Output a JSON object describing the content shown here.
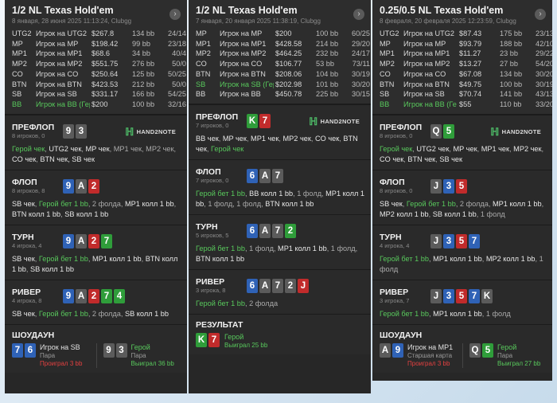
{
  "panels": [
    {
      "title": "1/2 NL Texas Hold'em",
      "subtitle": "8 января, 28 июня 2025 11:13:24, Clubgg",
      "players": [
        {
          "pos": "UTG2",
          "name": "Игрок на UTG2",
          "stack": "$267.8",
          "bb": "134 bb",
          "count": "24/14",
          "hero": false
        },
        {
          "pos": "MP",
          "name": "Игрок на MP",
          "stack": "$198.42",
          "bb": "99 bb",
          "count": "23/18",
          "hero": false
        },
        {
          "pos": "MP1",
          "name": "Игрок на MP1",
          "stack": "$68.6",
          "bb": "34 bb",
          "count": "40/4",
          "hero": false
        },
        {
          "pos": "MP2",
          "name": "Игрок на MP2",
          "stack": "$551.75",
          "bb": "276 bb",
          "count": "50/0",
          "hero": false
        },
        {
          "pos": "CO",
          "name": "Игрок на CO",
          "stack": "$250.64",
          "bb": "125 bb",
          "count": "50/25",
          "hero": false
        },
        {
          "pos": "BTN",
          "name": "Игрок на BTN",
          "stack": "$423.53",
          "bb": "212 bb",
          "count": "50/0",
          "hero": false
        },
        {
          "pos": "SB",
          "name": "Игрок на SB",
          "stack": "$331.17",
          "bb": "166 bb",
          "count": "54/25",
          "hero": false
        },
        {
          "pos": "BB",
          "name": "Игрок на BB (Гер",
          "stack": "$200",
          "bb": "100 bb",
          "count": "32/16",
          "hero": true
        }
      ],
      "logo": "HAND2NOTE",
      "sections": [
        {
          "name": "ПРЕФЛОП",
          "sub": "8 игроков, 0",
          "cards": [
            {
              "r": "9",
              "s": "s"
            },
            {
              "r": "3",
              "s": "s"
            }
          ],
          "actions": [
            [
              "Герой чек",
              "g"
            ],
            [
              ", ",
              "m"
            ],
            [
              "UTG2 чек",
              "w"
            ],
            [
              ", ",
              "m"
            ],
            [
              "MP чек",
              "w"
            ],
            [
              ", MP1 чек, MP2 чек, ",
              "m"
            ],
            [
              "CO чек",
              "w"
            ],
            [
              ", ",
              "m"
            ],
            [
              "BTN чек",
              "w"
            ],
            [
              ", SB чек",
              "w"
            ]
          ]
        },
        {
          "name": "ФЛОП",
          "sub": "8 игроков, 8",
          "cards": [
            {
              "r": "9",
              "s": "d"
            },
            {
              "r": "A",
              "s": "s"
            },
            {
              "r": "2",
              "s": "h"
            }
          ],
          "actions": [
            [
              "SB чек",
              "w"
            ],
            [
              ", ",
              "m"
            ],
            [
              "Герой бет 1 bb",
              "g"
            ],
            [
              ", 2 фолда, ",
              "m"
            ],
            [
              "MP1 колл 1 bb",
              "w"
            ],
            [
              ", ",
              "m"
            ],
            [
              "BTN колл 1 bb",
              "w"
            ],
            [
              ", ",
              "m"
            ],
            [
              "SB колл 1 bb",
              "w"
            ]
          ]
        },
        {
          "name": "ТУРН",
          "sub": "4 игрока, 4",
          "cards": [
            {
              "r": "9",
              "s": "d"
            },
            {
              "r": "A",
              "s": "s"
            },
            {
              "r": "2",
              "s": "h"
            },
            {
              "r": "7",
              "s": "c"
            }
          ],
          "actions": [
            [
              "SB чек",
              "w"
            ],
            [
              ", ",
              "m"
            ],
            [
              "Герой бет 1 bb",
              "g"
            ],
            [
              ", ",
              "m"
            ],
            [
              "MP1 колл 1 bb",
              "w"
            ],
            [
              ", ",
              "m"
            ],
            [
              "BTN колл 1 bb",
              "w"
            ],
            [
              ", ",
              "m"
            ],
            [
              "SB колл 1 bb",
              "w"
            ]
          ]
        },
        {
          "name": "РИВЕР",
          "sub": "4 игрока, 8",
          "cards": [
            {
              "r": "9",
              "s": "d"
            },
            {
              "r": "A",
              "s": "s"
            },
            {
              "r": "2",
              "s": "h"
            },
            {
              "r": "7",
              "s": "c"
            },
            {
              "r": "4",
              "s": "c"
            }
          ],
          "actions": [
            [
              "SB чек",
              "w"
            ],
            [
              ", ",
              "m"
            ],
            [
              "Герой бет 1 bb",
              "g"
            ],
            [
              ", 2 фолда, ",
              "m"
            ],
            [
              "SB колл 1 bb",
              "w"
            ]
          ]
        }
      ],
      "showdown": {
        "name": "ШОУДАУН",
        "left": {
          "cards": [
            {
              "r": "7",
              "s": "d"
            },
            {
              "r": "6",
              "s": "d"
            }
          ],
          "name": "Игрок на SB",
          "desc": "Пара",
          "result": "Проиграл 3 bb",
          "win": false
        },
        "right": {
          "cards": [
            {
              "r": "9",
              "s": "s"
            },
            {
              "r": "3",
              "s": "s"
            }
          ],
          "name": "Герой",
          "desc": "Пара",
          "result": "Выиграл 36 bb",
          "win": true
        }
      }
    },
    {
      "title": "1/2 NL Texas Hold'em",
      "subtitle": "7 января, 20 января 2025 11:38:19, Clubgg",
      "players": [
        {
          "pos": "MP",
          "name": "Игрок на MP",
          "stack": "$200",
          "bb": "100 bb",
          "count": "60/25",
          "hero": false
        },
        {
          "pos": "MP1",
          "name": "Игрок на MP1",
          "stack": "$428.58",
          "bb": "214 bb",
          "count": "29/20",
          "hero": false
        },
        {
          "pos": "MP2",
          "name": "Игрок на MP2",
          "stack": "$464.25",
          "bb": "232 bb",
          "count": "24/17",
          "hero": false
        },
        {
          "pos": "CO",
          "name": "Игрок на CO",
          "stack": "$106.77",
          "bb": "53 bb",
          "count": "73/11",
          "hero": false
        },
        {
          "pos": "BTN",
          "name": "Игрок на BTN",
          "stack": "$208.06",
          "bb": "104 bb",
          "count": "30/19",
          "hero": false
        },
        {
          "pos": "SB",
          "name": "Игрок на SB (Гер",
          "stack": "$202.98",
          "bb": "101 bb",
          "count": "30/20",
          "hero": true
        },
        {
          "pos": "BB",
          "name": "Игрок на BB",
          "stack": "$450.78",
          "bb": "225 bb",
          "count": "30/15",
          "hero": false
        }
      ],
      "logo": "HAND2NOTE",
      "sections": [
        {
          "name": "ПРЕФЛОП",
          "sub": "7 игроков, 0",
          "cards": [
            {
              "r": "K",
              "s": "c"
            },
            {
              "r": "7",
              "s": "h"
            }
          ],
          "actions": [
            [
              "BB чек",
              "w"
            ],
            [
              ", ",
              "m"
            ],
            [
              "MP чек",
              "w"
            ],
            [
              ", ",
              "m"
            ],
            [
              "MP1 чек",
              "w"
            ],
            [
              ", ",
              "m"
            ],
            [
              "MP2 чек",
              "w"
            ],
            [
              ", ",
              "m"
            ],
            [
              "CO чек",
              "w"
            ],
            [
              ", ",
              "m"
            ],
            [
              "BTN чек",
              "w"
            ],
            [
              ", ",
              "m"
            ],
            [
              "Герой чек",
              "g"
            ]
          ]
        },
        {
          "name": "ФЛОП",
          "sub": "7 игроков, 0",
          "cards": [
            {
              "r": "6",
              "s": "d"
            },
            {
              "r": "A",
              "s": "s"
            },
            {
              "r": "7",
              "s": "s"
            }
          ],
          "actions": [
            [
              "Герой бет 1 bb",
              "g"
            ],
            [
              ", ",
              "m"
            ],
            [
              "BB колл 1 bb",
              "w"
            ],
            [
              ", 1 фолд, ",
              "m"
            ],
            [
              "MP1 колл 1 bb",
              "w"
            ],
            [
              ", 1 фолд, 1 фолд, ",
              "m"
            ],
            [
              "BTN колл 1 bb",
              "w"
            ]
          ]
        },
        {
          "name": "ТУРН",
          "sub": "5 игроков, 5",
          "cards": [
            {
              "r": "6",
              "s": "d"
            },
            {
              "r": "A",
              "s": "s"
            },
            {
              "r": "7",
              "s": "s"
            },
            {
              "r": "2",
              "s": "c"
            }
          ],
          "actions": [
            [
              "Герой бет 1 bb",
              "g"
            ],
            [
              ", 1 фолд, ",
              "m"
            ],
            [
              "MP1 колл 1 bb",
              "w"
            ],
            [
              ", 1 фолд, ",
              "m"
            ],
            [
              "BTN колл 1 bb",
              "w"
            ]
          ]
        },
        {
          "name": "РИВЕР",
          "sub": "3 игрока, 8",
          "cards": [
            {
              "r": "6",
              "s": "d"
            },
            {
              "r": "A",
              "s": "s"
            },
            {
              "r": "7",
              "s": "s"
            },
            {
              "r": "2",
              "s": "s"
            },
            {
              "r": "J",
              "s": "h"
            }
          ],
          "actions": [
            [
              "Герой бет 1 bb",
              "g"
            ],
            [
              ", 2 фолда",
              "m"
            ]
          ]
        }
      ],
      "result": {
        "name": "РЕЗУЛЬТАТ",
        "cards": [
          {
            "r": "K",
            "s": "c"
          },
          {
            "r": "7",
            "s": "h"
          }
        ],
        "pname": "Герой",
        "result": "Выиграл 25 bb"
      }
    },
    {
      "title": "0.25/0.5 NL Texas Hold'em",
      "subtitle": "8 февраля, 20 февраля 2025 12:23:59, Clubgg",
      "players": [
        {
          "pos": "UTG2",
          "name": "Игрок на UTG2",
          "stack": "$87.43",
          "bb": "175 bb",
          "count": "23/13",
          "hero": false
        },
        {
          "pos": "MP",
          "name": "Игрок на MP",
          "stack": "$93.79",
          "bb": "188 bb",
          "count": "42/10",
          "hero": false
        },
        {
          "pos": "MP1",
          "name": "Игрок на MP1",
          "stack": "$11.27",
          "bb": "23 bb",
          "count": "29/22",
          "hero": false
        },
        {
          "pos": "MP2",
          "name": "Игрок на MP2",
          "stack": "$13.27",
          "bb": "27 bb",
          "count": "54/20",
          "hero": false
        },
        {
          "pos": "CO",
          "name": "Игрок на CO",
          "stack": "$67.08",
          "bb": "134 bb",
          "count": "30/20",
          "hero": false
        },
        {
          "pos": "BTN",
          "name": "Игрок на BTN",
          "stack": "$49.75",
          "bb": "100 bb",
          "count": "30/19",
          "hero": false
        },
        {
          "pos": "SB",
          "name": "Игрок на SB",
          "stack": "$70.74",
          "bb": "141 bb",
          "count": "43/13",
          "hero": false
        },
        {
          "pos": "BB",
          "name": "Игрок на BB (Ге",
          "stack": "$55",
          "bb": "110 bb",
          "count": "33/20",
          "hero": true
        }
      ],
      "logo": "HAND2NOTE",
      "sections": [
        {
          "name": "ПРЕФЛОП",
          "sub": "8 игроков, 0",
          "cards": [
            {
              "r": "Q",
              "s": "s"
            },
            {
              "r": "5",
              "s": "c"
            }
          ],
          "actions": [
            [
              "Герой чек",
              "g"
            ],
            [
              ", ",
              "m"
            ],
            [
              "UTG2 чек",
              "w"
            ],
            [
              ", ",
              "m"
            ],
            [
              "MP чек",
              "w"
            ],
            [
              ", ",
              "m"
            ],
            [
              "MP1 чек",
              "w"
            ],
            [
              ", ",
              "m"
            ],
            [
              "MP2 чек",
              "w"
            ],
            [
              ", ",
              "m"
            ],
            [
              "CO чек",
              "w"
            ],
            [
              ", ",
              "m"
            ],
            [
              "BTN чек",
              "w"
            ],
            [
              ", ",
              "m"
            ],
            [
              "SB чек",
              "w"
            ]
          ]
        },
        {
          "name": "ФЛОП",
          "sub": "8 игроков, 0",
          "cards": [
            {
              "r": "J",
              "s": "s"
            },
            {
              "r": "3",
              "s": "d"
            },
            {
              "r": "5",
              "s": "h"
            }
          ],
          "actions": [
            [
              "SB чек",
              "w"
            ],
            [
              ", ",
              "m"
            ],
            [
              "Герой бет 1 bb",
              "g"
            ],
            [
              ", 2 фолда, ",
              "m"
            ],
            [
              "MP1 колл 1 bb",
              "w"
            ],
            [
              ", ",
              "m"
            ],
            [
              "MP2 колл 1 bb",
              "w"
            ],
            [
              ", ",
              "m"
            ],
            [
              "SB колл 1 bb",
              "w"
            ],
            [
              ", 1 фолд",
              "m"
            ]
          ]
        },
        {
          "name": "ТУРН",
          "sub": "4 игрока, 4",
          "cards": [
            {
              "r": "J",
              "s": "s"
            },
            {
              "r": "3",
              "s": "d"
            },
            {
              "r": "5",
              "s": "h"
            },
            {
              "r": "7",
              "s": "d"
            }
          ],
          "actions": [
            [
              "Герой бет 1 bb",
              "g"
            ],
            [
              ", ",
              "m"
            ],
            [
              "MP1 колл 1 bb",
              "w"
            ],
            [
              ", ",
              "m"
            ],
            [
              "MP2 колл 1 bb",
              "w"
            ],
            [
              ", 1 фолд",
              "m"
            ]
          ]
        },
        {
          "name": "РИВЕР",
          "sub": "3 игрока, 7",
          "cards": [
            {
              "r": "J",
              "s": "s"
            },
            {
              "r": "3",
              "s": "d"
            },
            {
              "r": "5",
              "s": "h"
            },
            {
              "r": "7",
              "s": "d"
            },
            {
              "r": "K",
              "s": "s"
            }
          ],
          "actions": [
            [
              "Герой бет 1 bb",
              "g"
            ],
            [
              ", ",
              "m"
            ],
            [
              "MP1 колл 1 bb",
              "w"
            ],
            [
              ", 1 фолд",
              "m"
            ]
          ]
        }
      ],
      "showdown": {
        "name": "ШОУДАУН",
        "left": {
          "cards": [
            {
              "r": "A",
              "s": "s"
            },
            {
              "r": "9",
              "s": "d"
            }
          ],
          "name": "Игрок на MP1",
          "desc": "Старшая карта",
          "result": "Проиграл 3 bb",
          "win": false
        },
        "right": {
          "cards": [
            {
              "r": "Q",
              "s": "s"
            },
            {
              "r": "5",
              "s": "c"
            }
          ],
          "name": "Герой",
          "desc": "Пара",
          "result": "Выиграл 27 bb",
          "win": true
        }
      }
    }
  ],
  "colors": {
    "panel_bg": "#272727",
    "hero_green": "#58c85c",
    "lose_red": "#e34040",
    "suit_spade": "#5b5b5b",
    "suit_heart": "#c12b2b",
    "suit_diamond": "#2f62b6",
    "suit_club": "#2f9d3a"
  }
}
